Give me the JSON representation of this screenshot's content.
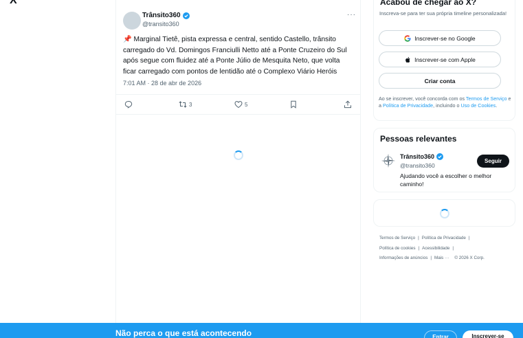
{
  "brand": {
    "logo_text": "X",
    "accent": "#1d9bf0"
  },
  "tweet": {
    "author_name": "Trânsito360",
    "handle": "@transito360",
    "more_label": "···",
    "text": "📌 Marginal Tietê, pista expressa e central, sentido Castello, trânsito carregado do Vd. Domingos Franciulli Netto até a Ponte Cruzeiro do Sul após segue com fluidez até a Ponte Júlio de Mesquita Neto, que volta ficar carregado com pontos de lentidão até o Complexo Viário Heróis",
    "timestamp": "7:01 AM · 28 de abr de 2026",
    "retweets": "3",
    "likes": "5"
  },
  "signup_card": {
    "title": "Acabou de chegar ao X?",
    "subtitle": "Inscreva-se para ter sua própria timeline personalizada!",
    "google_label": "Inscrever-se no Google",
    "apple_label": "Inscrever-se com Apple",
    "create_label": "Criar conta",
    "legal_prefix": "Ao se inscrever, você concorda com os ",
    "terms_link": "Termos de Serviço",
    "legal_mid": " e a ",
    "privacy_link": "Política de Privacidade",
    "legal_mid2": ", incluindo o ",
    "cookies_link": "Uso de Cookies",
    "legal_end": "."
  },
  "people": {
    "title": "Pessoas relevantes",
    "name": "Trânsito360",
    "handle": "@transito360",
    "follow_label": "Seguir",
    "bio": "Ajudando você a escolher o melhor caminho!"
  },
  "footer": {
    "terms": "Termos de Serviço",
    "privacy": "Política de Privacidade",
    "cookies": "Política de cookies",
    "accessibility": "Acessibilidade",
    "ads": "Informações de anúncios",
    "more": "Mais ···",
    "copyright": "© 2026 X Corp."
  },
  "bottom_bar": {
    "title": "Não perca o que está acontecendo",
    "login_label": "Entrar",
    "signup_label": "Inscrever-se"
  }
}
